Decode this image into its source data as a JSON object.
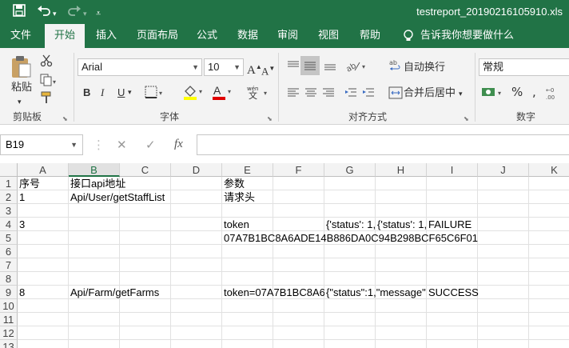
{
  "window": {
    "title": "testreport_20190216105910.xls"
  },
  "qat": {
    "save_icon": "save-icon",
    "undo_icon": "undo-icon",
    "redo_icon": "redo-icon",
    "customize_icon": "customize-icon"
  },
  "tabs": [
    "文件",
    "开始",
    "插入",
    "页面布局",
    "公式",
    "数据",
    "审阅",
    "视图",
    "帮助"
  ],
  "tell_me": "告诉我你想要做什么",
  "ribbon": {
    "clipboard": {
      "paste": "粘贴",
      "label": "剪贴板"
    },
    "font": {
      "name": "Arial",
      "size": "10",
      "label": "字体",
      "bold": "B",
      "italic": "I",
      "underline": "U"
    },
    "alignment": {
      "wrap": "自动换行",
      "merge": "合并后居中",
      "label": "对齐方式"
    },
    "number": {
      "format": "常规",
      "label": "数字"
    }
  },
  "formula_bar": {
    "name_box": "B19",
    "fx": "fx",
    "content": ""
  },
  "columns": [
    "A",
    "B",
    "C",
    "D",
    "E",
    "F",
    "G",
    "H",
    "I",
    "J",
    "K"
  ],
  "selected": {
    "col": "B",
    "row": "19"
  },
  "rows": [
    "1",
    "2",
    "3",
    "4",
    "5",
    "6",
    "7",
    "8",
    "9",
    "10",
    "11",
    "12",
    "13"
  ],
  "cells": {
    "A1": "序号",
    "B1": "接口api地址",
    "E1": "参数",
    "A2": "1",
    "B2": "Api/User/getStaffList",
    "E2": "请求头",
    "A4": "3",
    "E4": "token",
    "G4": "{'status': 1,",
    "H4": "{'status': 1,",
    "I4": "FAILURE",
    "E5": "07A7B1BC8A6ADE14B886DA0C94B298BCF65C6F01",
    "A9": "8",
    "B9": "Api/Farm/getFarms",
    "E9": "token=07A7B1BC8A6",
    "G9": "{\"status\":1,\"message\"",
    "I9": "SUCCESS"
  }
}
